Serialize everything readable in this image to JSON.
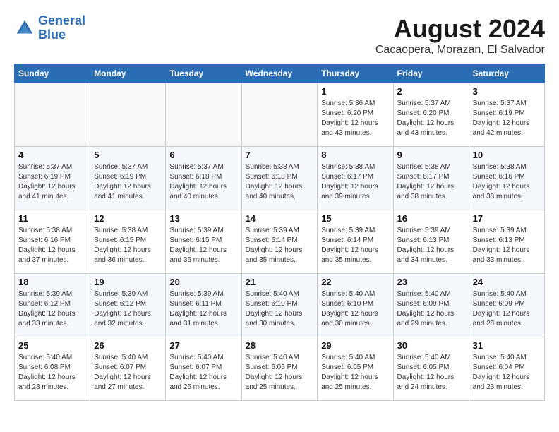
{
  "header": {
    "logo_line1": "General",
    "logo_line2": "Blue",
    "title": "August 2024",
    "subtitle": "Cacaopera, Morazan, El Salvador"
  },
  "days_of_week": [
    "Sunday",
    "Monday",
    "Tuesday",
    "Wednesday",
    "Thursday",
    "Friday",
    "Saturday"
  ],
  "weeks": [
    [
      {
        "day": "",
        "info": ""
      },
      {
        "day": "",
        "info": ""
      },
      {
        "day": "",
        "info": ""
      },
      {
        "day": "",
        "info": ""
      },
      {
        "day": "1",
        "info": "Sunrise: 5:36 AM\nSunset: 6:20 PM\nDaylight: 12 hours\nand 43 minutes."
      },
      {
        "day": "2",
        "info": "Sunrise: 5:37 AM\nSunset: 6:20 PM\nDaylight: 12 hours\nand 43 minutes."
      },
      {
        "day": "3",
        "info": "Sunrise: 5:37 AM\nSunset: 6:19 PM\nDaylight: 12 hours\nand 42 minutes."
      }
    ],
    [
      {
        "day": "4",
        "info": "Sunrise: 5:37 AM\nSunset: 6:19 PM\nDaylight: 12 hours\nand 41 minutes."
      },
      {
        "day": "5",
        "info": "Sunrise: 5:37 AM\nSunset: 6:19 PM\nDaylight: 12 hours\nand 41 minutes."
      },
      {
        "day": "6",
        "info": "Sunrise: 5:37 AM\nSunset: 6:18 PM\nDaylight: 12 hours\nand 40 minutes."
      },
      {
        "day": "7",
        "info": "Sunrise: 5:38 AM\nSunset: 6:18 PM\nDaylight: 12 hours\nand 40 minutes."
      },
      {
        "day": "8",
        "info": "Sunrise: 5:38 AM\nSunset: 6:17 PM\nDaylight: 12 hours\nand 39 minutes."
      },
      {
        "day": "9",
        "info": "Sunrise: 5:38 AM\nSunset: 6:17 PM\nDaylight: 12 hours\nand 38 minutes."
      },
      {
        "day": "10",
        "info": "Sunrise: 5:38 AM\nSunset: 6:16 PM\nDaylight: 12 hours\nand 38 minutes."
      }
    ],
    [
      {
        "day": "11",
        "info": "Sunrise: 5:38 AM\nSunset: 6:16 PM\nDaylight: 12 hours\nand 37 minutes."
      },
      {
        "day": "12",
        "info": "Sunrise: 5:38 AM\nSunset: 6:15 PM\nDaylight: 12 hours\nand 36 minutes."
      },
      {
        "day": "13",
        "info": "Sunrise: 5:39 AM\nSunset: 6:15 PM\nDaylight: 12 hours\nand 36 minutes."
      },
      {
        "day": "14",
        "info": "Sunrise: 5:39 AM\nSunset: 6:14 PM\nDaylight: 12 hours\nand 35 minutes."
      },
      {
        "day": "15",
        "info": "Sunrise: 5:39 AM\nSunset: 6:14 PM\nDaylight: 12 hours\nand 35 minutes."
      },
      {
        "day": "16",
        "info": "Sunrise: 5:39 AM\nSunset: 6:13 PM\nDaylight: 12 hours\nand 34 minutes."
      },
      {
        "day": "17",
        "info": "Sunrise: 5:39 AM\nSunset: 6:13 PM\nDaylight: 12 hours\nand 33 minutes."
      }
    ],
    [
      {
        "day": "18",
        "info": "Sunrise: 5:39 AM\nSunset: 6:12 PM\nDaylight: 12 hours\nand 33 minutes."
      },
      {
        "day": "19",
        "info": "Sunrise: 5:39 AM\nSunset: 6:12 PM\nDaylight: 12 hours\nand 32 minutes."
      },
      {
        "day": "20",
        "info": "Sunrise: 5:39 AM\nSunset: 6:11 PM\nDaylight: 12 hours\nand 31 minutes."
      },
      {
        "day": "21",
        "info": "Sunrise: 5:40 AM\nSunset: 6:10 PM\nDaylight: 12 hours\nand 30 minutes."
      },
      {
        "day": "22",
        "info": "Sunrise: 5:40 AM\nSunset: 6:10 PM\nDaylight: 12 hours\nand 30 minutes."
      },
      {
        "day": "23",
        "info": "Sunrise: 5:40 AM\nSunset: 6:09 PM\nDaylight: 12 hours\nand 29 minutes."
      },
      {
        "day": "24",
        "info": "Sunrise: 5:40 AM\nSunset: 6:09 PM\nDaylight: 12 hours\nand 28 minutes."
      }
    ],
    [
      {
        "day": "25",
        "info": "Sunrise: 5:40 AM\nSunset: 6:08 PM\nDaylight: 12 hours\nand 28 minutes."
      },
      {
        "day": "26",
        "info": "Sunrise: 5:40 AM\nSunset: 6:07 PM\nDaylight: 12 hours\nand 27 minutes."
      },
      {
        "day": "27",
        "info": "Sunrise: 5:40 AM\nSunset: 6:07 PM\nDaylight: 12 hours\nand 26 minutes."
      },
      {
        "day": "28",
        "info": "Sunrise: 5:40 AM\nSunset: 6:06 PM\nDaylight: 12 hours\nand 25 minutes."
      },
      {
        "day": "29",
        "info": "Sunrise: 5:40 AM\nSunset: 6:05 PM\nDaylight: 12 hours\nand 25 minutes."
      },
      {
        "day": "30",
        "info": "Sunrise: 5:40 AM\nSunset: 6:05 PM\nDaylight: 12 hours\nand 24 minutes."
      },
      {
        "day": "31",
        "info": "Sunrise: 5:40 AM\nSunset: 6:04 PM\nDaylight: 12 hours\nand 23 minutes."
      }
    ]
  ]
}
